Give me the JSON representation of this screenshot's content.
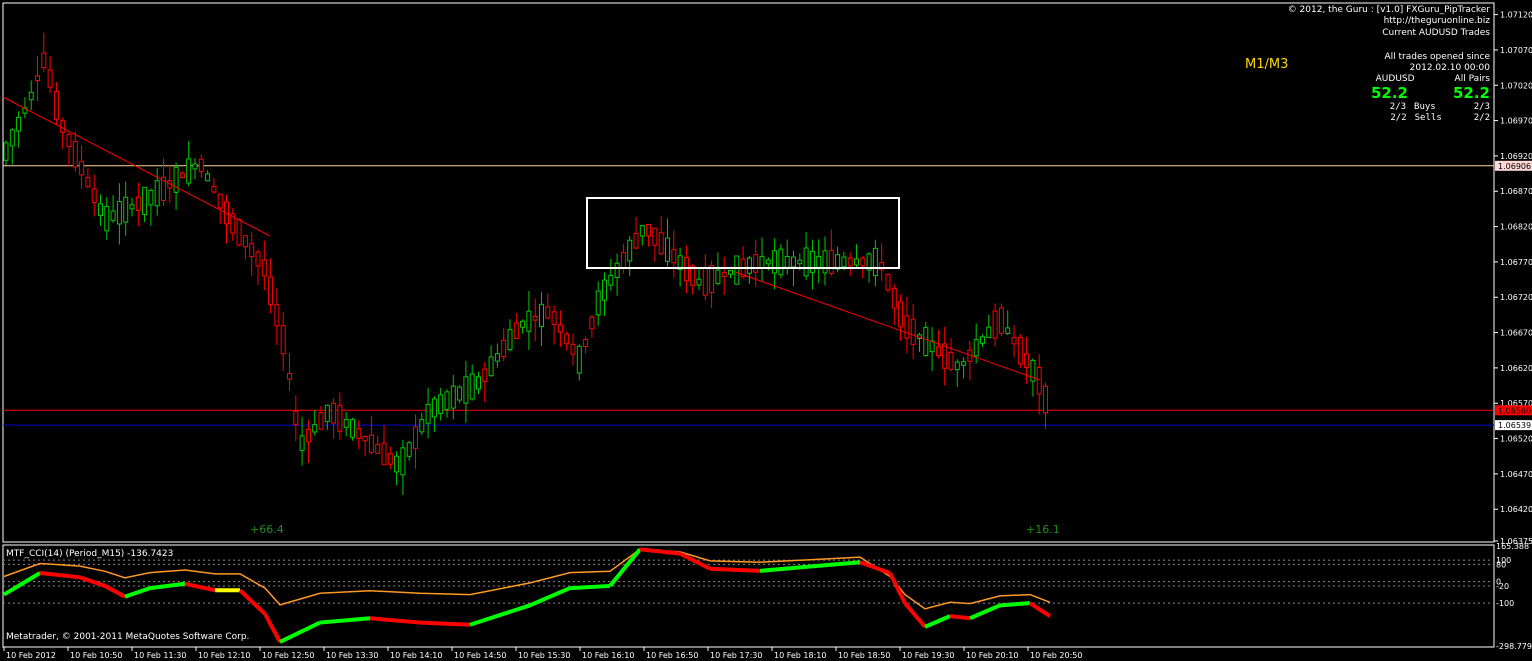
{
  "app": {
    "credit": "Metatrader, © 2001-2011 MetaQuotes Software Corp."
  },
  "chart_data": [
    {
      "type": "candlestick",
      "symbol": "AUDUSD",
      "timeframe_label": "M1/M3",
      "ylim": [
        1.06375,
        1.07135
      ],
      "y_ticks": [
        "1.07120",
        "1.07070",
        "1.07020",
        "1.06970",
        "1.06920",
        "1.06870",
        "1.06820",
        "1.06770",
        "1.06720",
        "1.06670",
        "1.06620",
        "1.06570",
        "1.06520",
        "1.06470",
        "1.06420",
        "1.06375"
      ],
      "y_tick_values": [
        1.0712,
        1.0707,
        1.0702,
        1.0697,
        1.0692,
        1.0687,
        1.0682,
        1.0677,
        1.0672,
        1.0667,
        1.0662,
        1.0657,
        1.0652,
        1.0647,
        1.0642,
        1.06375
      ],
      "x_ticks": [
        "10 Feb 2012",
        "10 Feb 10:50",
        "10 Feb 11:30",
        "10 Feb 12:10",
        "10 Feb 12:50",
        "10 Feb 13:30",
        "10 Feb 14:10",
        "10 Feb 14:50",
        "10 Feb 15:30",
        "10 Feb 16:10",
        "10 Feb 16:50",
        "10 Feb 17:30",
        "10 Feb 18:10",
        "10 Feb 18:50",
        "10 Feb 19:30",
        "10 Feb 20:10",
        "10 Feb 20:50"
      ],
      "horizontal_lines": [
        {
          "value": 1.06906,
          "label": "1.06906",
          "color": "#ffd79a",
          "label_bg": "#ffd7d7"
        },
        {
          "value": 1.0656,
          "label": "1.06560",
          "color": "#ff0000",
          "label_bg": "#ff0000"
        },
        {
          "value": 1.06539,
          "label": "1.06539",
          "color": "#0000cc",
          "label_bg": "#ffffff"
        }
      ],
      "annotations": [
        {
          "text": "+66.4",
          "color": "#1e8c1e"
        },
        {
          "text": "+16.1",
          "color": "#1e8c1e"
        }
      ],
      "colors": {
        "bull": "#00c800",
        "bear": "#ff0000",
        "trendline": "#ff0000",
        "box": "#ffffff"
      }
    },
    {
      "type": "line",
      "title": "MTF_CCI(14) (Period_M15) -136.7423",
      "ylim": [
        -298.779,
        165.388
      ],
      "y_ticks": [
        "165.388",
        "100",
        "80",
        "0",
        "-100",
        "-20",
        "-298.779"
      ],
      "levels": [
        100,
        80,
        0,
        -100,
        -20
      ],
      "series": [
        {
          "color": "#ff9922"
        },
        {
          "colors": [
            "#ff0000",
            "#ffff00",
            "#00ff00"
          ]
        }
      ]
    }
  ],
  "tracker": {
    "header": [
      "© 2012, the Guru : [v1.0] FXGuru_PipTracker",
      "http://theguruonline.biz",
      "Current AUDUSD Trades"
    ],
    "since_label": "All trades opened since",
    "since_date": "2012.02.10 00:00",
    "col1": "AUDUSD",
    "col2": "All Pairs",
    "pips1": "52.2",
    "pips2": "52.2",
    "buys_left": "2/3",
    "buys_label": "Buys",
    "buys_right": "2/3",
    "sells_left": "2/2",
    "sells_label": "Sells",
    "sells_right": "2/2"
  }
}
